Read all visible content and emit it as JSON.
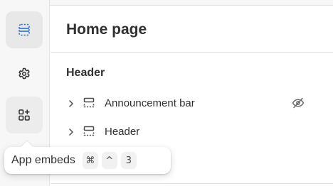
{
  "rail": {
    "items": [
      {
        "icon": "sections-icon",
        "active": true
      },
      {
        "icon": "gear-icon",
        "active": false
      },
      {
        "icon": "app-blocks-icon",
        "active": false
      }
    ]
  },
  "panel": {
    "title": "Home page",
    "section_group": "Header",
    "rows": [
      {
        "label": "Announcement bar",
        "hidden": true
      },
      {
        "label": "Header",
        "hidden": false
      }
    ]
  },
  "tooltip": {
    "label": "App embeds",
    "keys": [
      "⌘",
      "^",
      "3"
    ]
  },
  "colors": {
    "active_icon": "#2c6ecb",
    "rail_bg": "#f7f7f7",
    "text": "#303030",
    "muted_icon": "#4a4a4a"
  }
}
